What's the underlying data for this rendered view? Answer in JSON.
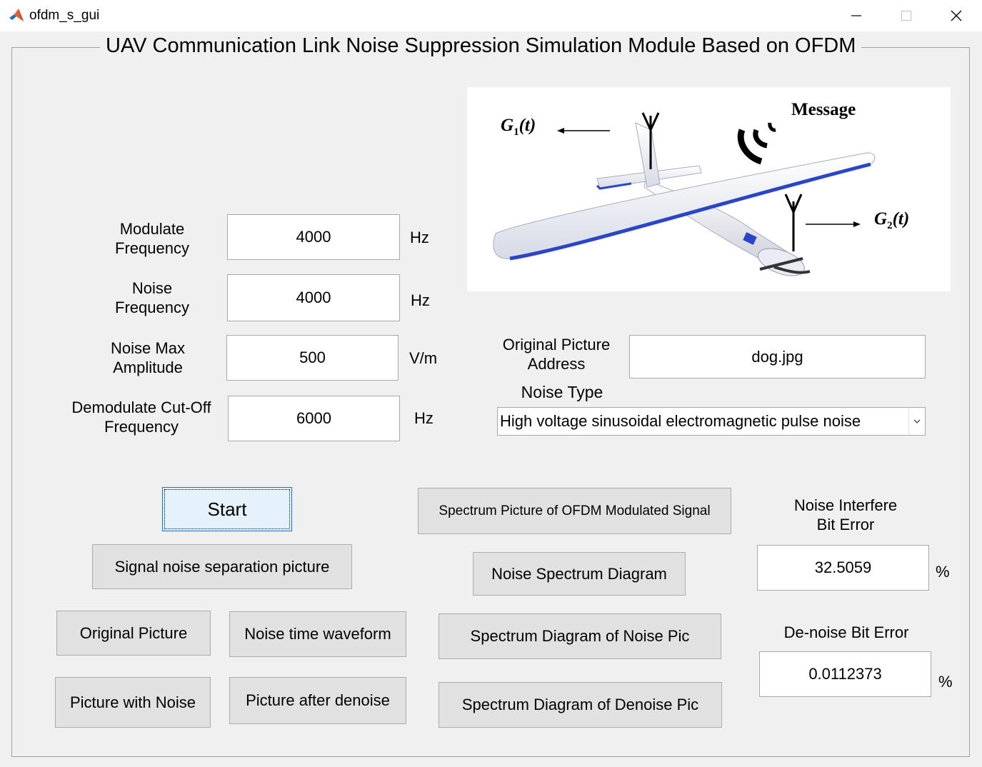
{
  "window": {
    "title": "ofdm_s_gui",
    "icons": [
      "matlab-logo-icon",
      "minimize-icon",
      "maximize-icon",
      "close-icon"
    ]
  },
  "panel": {
    "title": "UAV Communication Link Noise Suppression Simulation Module Based on OFDM"
  },
  "params": {
    "modulate_frequency": {
      "label": "Modulate\nFrequency",
      "value": "4000",
      "unit": "Hz"
    },
    "noise_frequency": {
      "label": "Noise\nFrequency",
      "value": "4000",
      "unit": "Hz"
    },
    "noise_max_amplitude": {
      "label": "Noise Max\nAmplitude",
      "value": "500",
      "unit": "V/m"
    },
    "demodulate_cutoff": {
      "label": "Demodulate Cut-Off\nFrequency",
      "value": "6000",
      "unit": "Hz"
    }
  },
  "figure": {
    "g1_base": "G",
    "g1_sub": "1",
    "g1_tail": "(t)",
    "g2_base": "G",
    "g2_sub": "2",
    "g2_tail": "(t)",
    "message": "Message",
    "colors": {
      "wing_blue": "#2a45c8",
      "antenna": "#000000"
    }
  },
  "picture": {
    "label": "Original Picture\nAddress",
    "value": "dog.jpg"
  },
  "noise_type": {
    "label": "Noise Type",
    "selected": "High voltage sinusoidal electromagnetic pulse noise"
  },
  "buttons": {
    "start": "Start",
    "signal_noise_separation": "Signal noise separation picture",
    "original_picture": "Original Picture",
    "noise_time_waveform": "Noise time waveform",
    "picture_with_noise": "Picture with Noise",
    "picture_after_denoise": "Picture after denoise",
    "spectrum_ofdm": "Spectrum Picture of OFDM Modulated Signal",
    "noise_spectrum": "Noise Spectrum Diagram",
    "spectrum_noise_pic": "Spectrum Diagram of Noise Pic",
    "spectrum_denoise_pic": "Spectrum Diagram of Denoise Pic"
  },
  "results": {
    "noise_interfere": {
      "label": "Noise Interfere\nBit Error",
      "value": "32.5059",
      "unit": "%"
    },
    "denoise": {
      "label": "De-noise Bit Error",
      "value": "0.0112373",
      "unit": "%"
    }
  }
}
